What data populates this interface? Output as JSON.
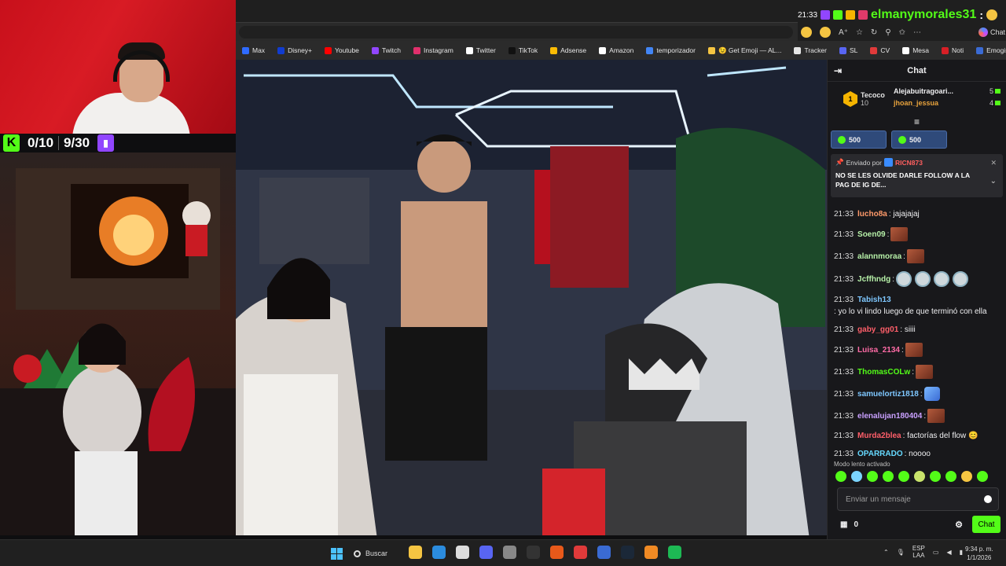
{
  "bookmarks": [
    {
      "label": "Max",
      "color": "#2f6bff"
    },
    {
      "label": "Disney+",
      "color": "#113ccf"
    },
    {
      "label": "Youtube",
      "color": "#ff0000"
    },
    {
      "label": "Twitch",
      "color": "#9146ff"
    },
    {
      "label": "Instagram",
      "color": "#e1306c"
    },
    {
      "label": "Twitter",
      "color": "#ffffff"
    },
    {
      "label": "TikTok",
      "color": "#111111"
    },
    {
      "label": "Adsense",
      "color": "#fbbc04"
    },
    {
      "label": "Amazon",
      "color": "#ffffff"
    },
    {
      "label": "temporizador",
      "color": "#4285f4"
    },
    {
      "label": "😉 Get Emoji — AL...",
      "color": "#f5c542"
    },
    {
      "label": "Tracker",
      "color": "#e6e6e6"
    },
    {
      "label": "SL",
      "color": "#5865f2"
    },
    {
      "label": "CV",
      "color": "#e03a3a"
    },
    {
      "label": "Mesa",
      "color": "#ffffff"
    },
    {
      "label": "Noti",
      "color": "#d71f26"
    },
    {
      "label": "Emogis",
      "color": "#3a6bd4"
    }
  ],
  "overlay": {
    "kick_count": "0/10",
    "twitch_count": "9/30"
  },
  "topright": {
    "time": "21:33",
    "username": "elmanymorales31",
    "colon": ":",
    "chat_label": "Chat"
  },
  "chat": {
    "title": "Chat",
    "leaderboard": {
      "first_rank": "1",
      "first_name": "Tecoco",
      "first_value": "10",
      "rows": [
        {
          "name": "Alejabuitragoari...",
          "value": "5"
        },
        {
          "name": "jhoan_jessua",
          "value": "4"
        }
      ]
    },
    "gifts": [
      {
        "amount": "500"
      },
      {
        "amount": "500"
      }
    ],
    "pinned": {
      "sent_by": "Enviado por",
      "pinned_user": "RICN873",
      "message": "NO SE LES OLVIDE DARLE FOLLOW A LA PAG DE IG DE..."
    },
    "messages": [
      {
        "time": "21:33",
        "user": "lucho8a",
        "text": ": jajajajaj",
        "color": "c1",
        "emotes": 0
      },
      {
        "time": "21:33",
        "user": "Soen09",
        "text": ":",
        "color": "c2",
        "emotes": 1
      },
      {
        "time": "21:33",
        "user": "alannmoraa",
        "text": ":",
        "color": "c2",
        "emotes": 1
      },
      {
        "time": "21:33",
        "user": "Jcffhndg",
        "text": ":",
        "color": "c2",
        "emotes": 4
      },
      {
        "time": "21:33",
        "user": "Tabish13",
        "text": ": yo lo vi lindo luego de que terminó con ella",
        "color": "c3",
        "emotes": 0
      },
      {
        "time": "21:33",
        "user": "gaby_gg01",
        "text": ": siiii",
        "color": "c4",
        "emotes": 0
      },
      {
        "time": "21:33",
        "user": "Luisa_2134",
        "text": ":",
        "color": "c7",
        "emotes": 1
      },
      {
        "time": "21:33",
        "user": "ThomasCOLw",
        "text": ":",
        "color": "c6",
        "emotes": 1
      },
      {
        "time": "21:33",
        "user": "samuelortiz1818",
        "text": ":",
        "color": "c3",
        "emotes": 1
      },
      {
        "time": "21:33",
        "user": "elenalujan180404",
        "text": ":",
        "color": "c5",
        "emotes": 1
      },
      {
        "time": "21:33",
        "user": "Murda2blea",
        "text": ": factorías del flow 😊",
        "color": "c4",
        "emotes": 0
      },
      {
        "time": "21:33",
        "user": "OPARRADO",
        "text": ": noooo",
        "color": "c8",
        "emotes": 0
      }
    ],
    "slow_mode": "Modo lento activado",
    "input_placeholder": "Enviar un mensaje",
    "points": "0",
    "send_label": "Chat"
  },
  "taskbar": {
    "search_label": "Buscar",
    "lang_top": "ESP",
    "lang_bottom": "LAA",
    "time": "9:34 p. m.",
    "date": "1/1/2026"
  }
}
